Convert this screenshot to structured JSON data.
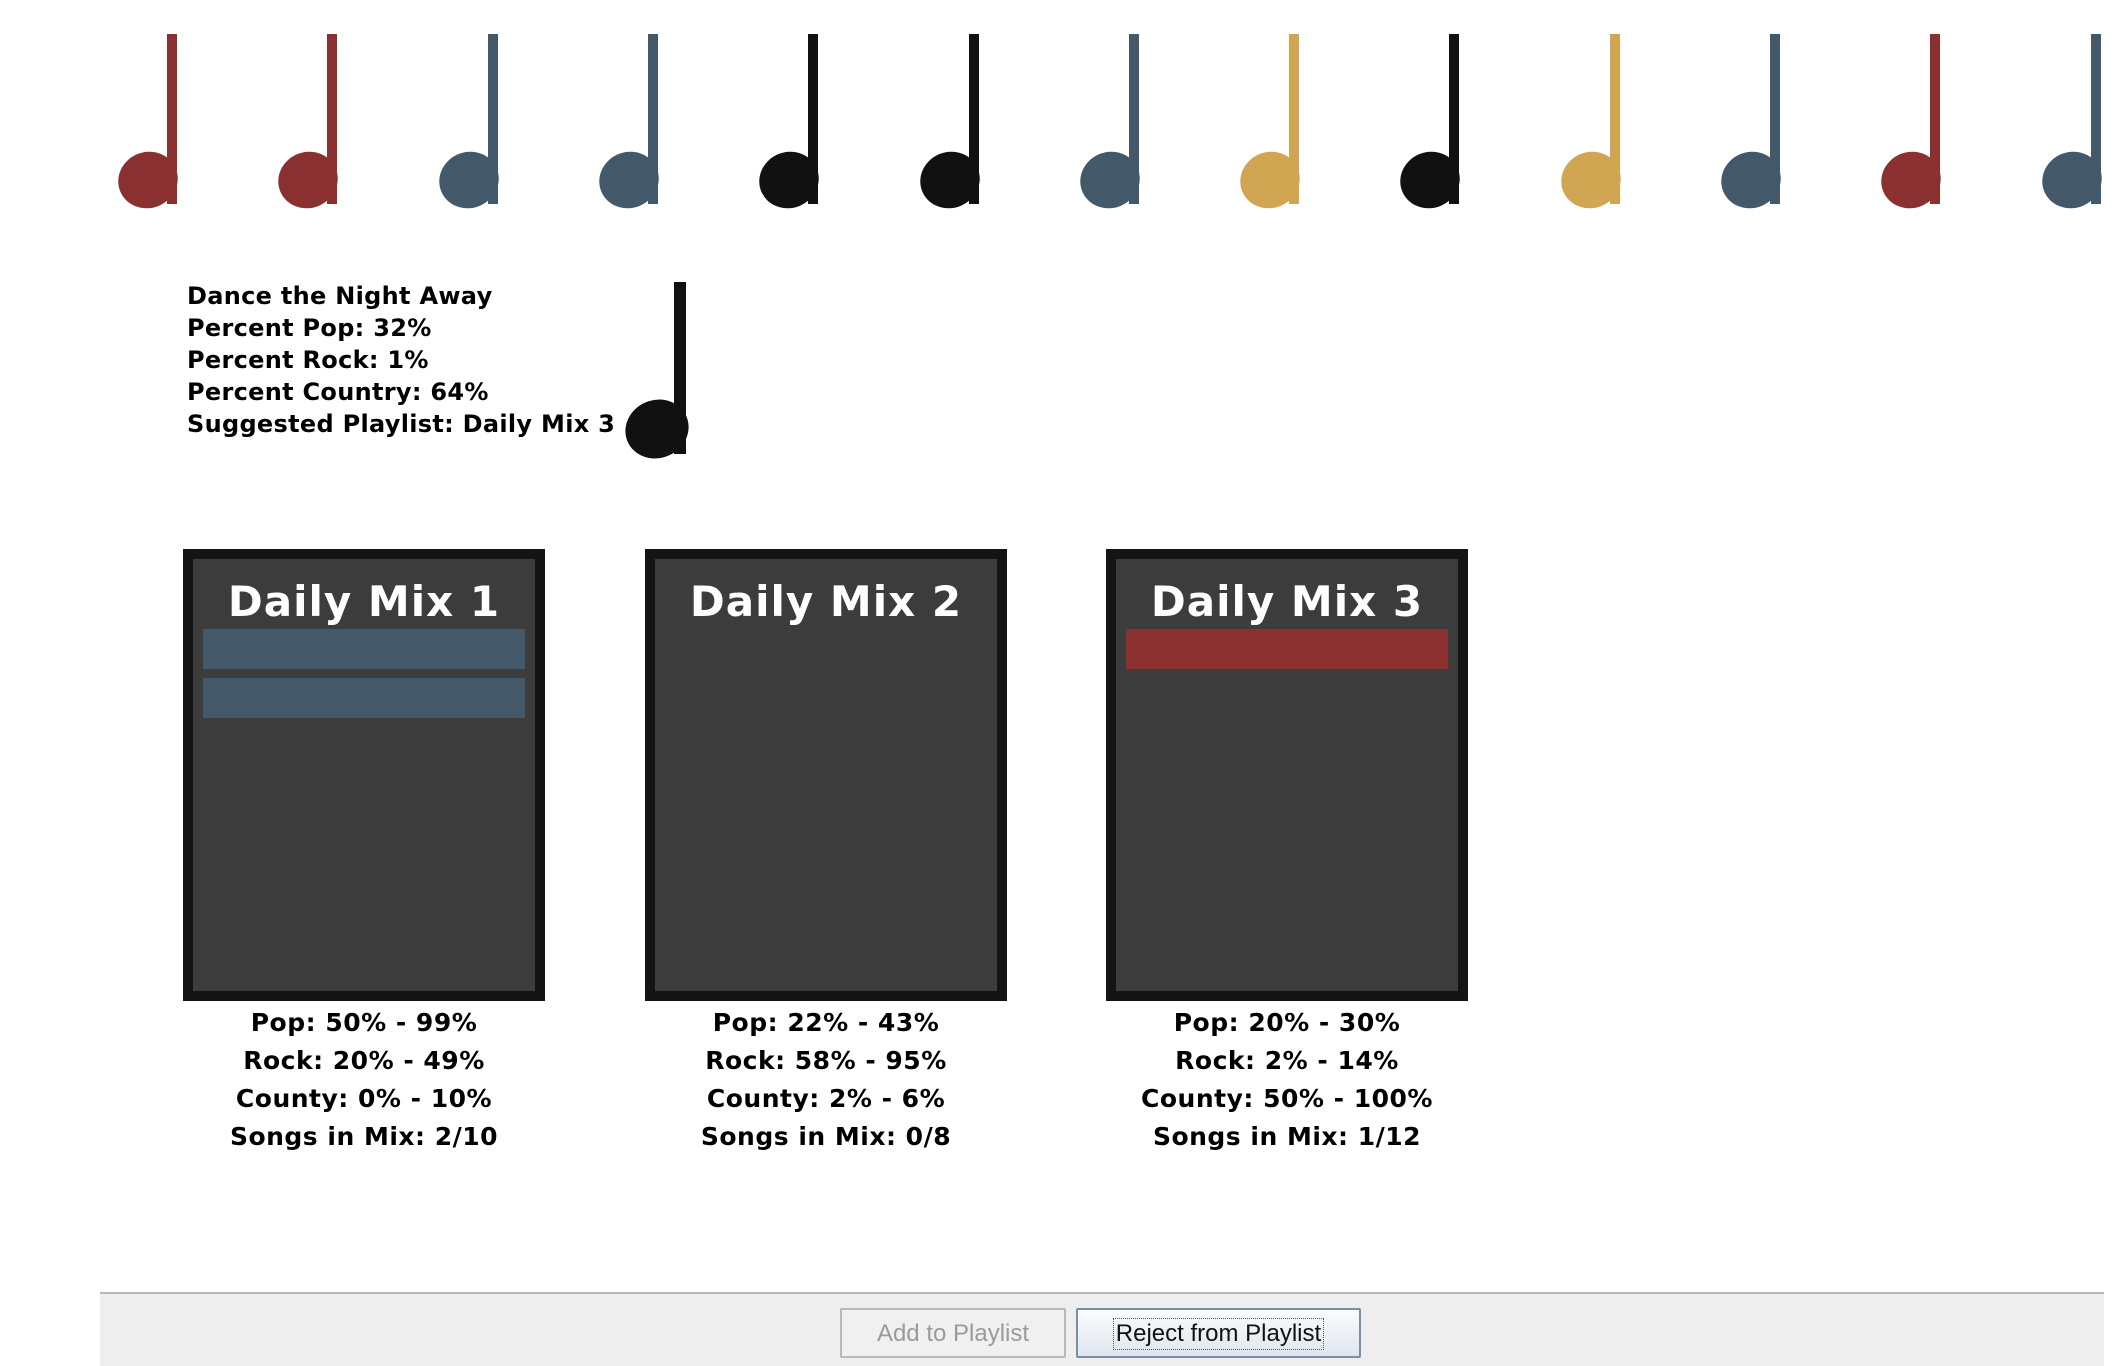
{
  "colors": {
    "red": "#8b3030",
    "slate": "#43596a",
    "black": "#111111",
    "gold": "#d1a652",
    "card_bg": "#3c3c3c",
    "card_border": "#141414"
  },
  "notes_row": [
    {
      "icon": "music-note-icon",
      "color": "#8b3030"
    },
    {
      "icon": "music-note-icon",
      "color": "#8b3030"
    },
    {
      "icon": "music-note-icon",
      "color": "#43596a"
    },
    {
      "icon": "music-note-icon",
      "color": "#43596a"
    },
    {
      "icon": "music-note-icon",
      "color": "#111111"
    },
    {
      "icon": "music-note-icon",
      "color": "#111111"
    },
    {
      "icon": "music-note-icon",
      "color": "#43596a"
    },
    {
      "icon": "music-note-icon",
      "color": "#d1a652"
    },
    {
      "icon": "music-note-icon",
      "color": "#111111"
    },
    {
      "icon": "music-note-icon",
      "color": "#d1a652"
    },
    {
      "icon": "music-note-icon",
      "color": "#43596a"
    },
    {
      "icon": "music-note-icon",
      "color": "#8b3030"
    },
    {
      "icon": "music-note-icon",
      "color": "#43596a"
    }
  ],
  "current_song": {
    "title": "Dance the Night Away",
    "percent_pop": "Percent Pop: 32%",
    "percent_rock": "Percent Rock: 1%",
    "percent_country": "Percent Country: 64%",
    "suggested": "Suggested Playlist: Daily Mix 3",
    "note_color": "#111111"
  },
  "mixes": [
    {
      "title": "Daily Mix 1",
      "songs": [
        {
          "color": "#43596a"
        },
        {
          "color": "#43596a"
        }
      ],
      "pop": "Pop: 50% - 99%",
      "rock": "Rock: 20% - 49%",
      "country": "County: 0% - 10%",
      "count": "Songs in Mix: 2/10"
    },
    {
      "title": "Daily Mix 2",
      "songs": [],
      "pop": "Pop: 22% - 43%",
      "rock": "Rock: 58% - 95%",
      "country": "County: 2% - 6%",
      "count": "Songs in Mix: 0/8"
    },
    {
      "title": "Daily Mix 3",
      "songs": [
        {
          "color": "#8b3030"
        }
      ],
      "pop": "Pop: 20% - 30%",
      "rock": "Rock: 2% - 14%",
      "country": "County: 50% - 100%",
      "count": "Songs in Mix: 1/12"
    }
  ],
  "buttons": {
    "add_label": "Add to Playlist",
    "add_disabled": true,
    "reject_label": "Reject from Playlist"
  }
}
